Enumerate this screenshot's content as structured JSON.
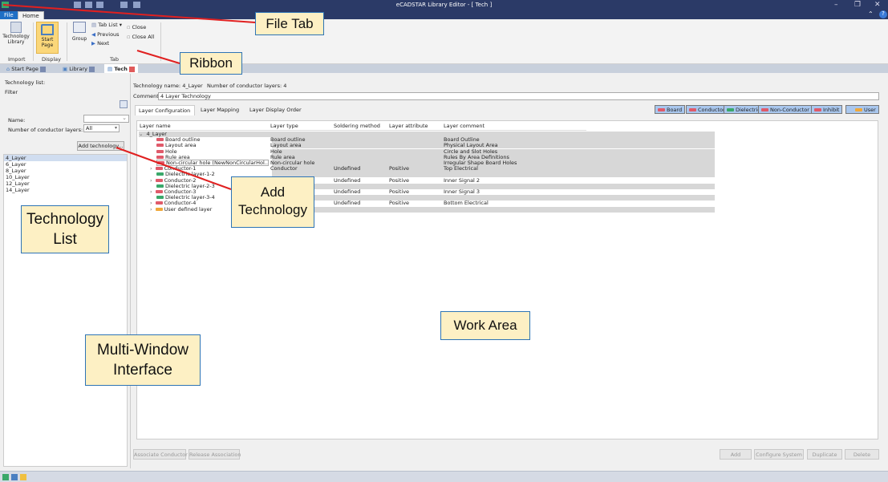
{
  "window": {
    "title": "eCADSTAR Library Editor - [ Tech ]",
    "controls": [
      "–",
      "❐",
      "✕"
    ]
  },
  "ribbon_tabs": {
    "file": "File",
    "home": "Home"
  },
  "ribbon": {
    "technology_library": "Technology Library",
    "start_page": "Start Page",
    "group": "Group",
    "tab_list": "Tab List",
    "previous": "Previous",
    "next": "Next",
    "close": "Close",
    "close_all": "Close All",
    "group_import": "Import",
    "group_display": "Display",
    "group_tab": "Tab"
  },
  "doc_tabs": [
    "Start Page",
    "Library",
    "Tech"
  ],
  "left_panel": {
    "title": "Technology list:",
    "filter": "Filter",
    "name_label": "Name:",
    "layers_label": "Number of conductor layers:",
    "layers_value": "All",
    "add_button": "Add technology...",
    "items": [
      "4_Layer",
      "6_Layer",
      "8_Layer",
      "10_Layer",
      "12_Layer",
      "14_Layer"
    ]
  },
  "main": {
    "technology_name_label": "Technology name:",
    "technology_name": "4_Layer",
    "conductor_layers_label": "Number of conductor layers:",
    "conductor_layers": "4",
    "comment_label": "Comment:",
    "comment": "4 Layer Technology",
    "tabs": [
      "Layer Configuration",
      "Layer Mapping",
      "Layer Display Order"
    ],
    "filters": [
      "Board",
      "Conductor",
      "Dielectric",
      "Non-Conductor",
      "Inhibit",
      "User"
    ],
    "columns": [
      "Layer name",
      "Layer type",
      "Soldering method",
      "Layer attribute",
      "Layer comment"
    ],
    "rows": [
      {
        "name": "4_Layer",
        "type": "",
        "solder": "",
        "attr": "",
        "comment": ""
      },
      {
        "name": "Board outline",
        "type": "Board outline",
        "solder": "",
        "attr": "",
        "comment": "Board Outline"
      },
      {
        "name": "Layout area",
        "type": "Layout area",
        "solder": "",
        "attr": "",
        "comment": "Physical Layout Area"
      },
      {
        "name": "Hole",
        "type": "Hole",
        "solder": "",
        "attr": "",
        "comment": "Circle and Slot Holes"
      },
      {
        "name": "Rule area",
        "type": "Rule area",
        "solder": "",
        "attr": "",
        "comment": "Rules By Area Definitions"
      },
      {
        "name": "Non-circular hole (NewNonCircularHol...",
        "type": "Non-circular hole",
        "solder": "",
        "attr": "",
        "comment": "Irregular Shape Board Holes"
      },
      {
        "name": "Conductor-1",
        "type": "Conductor",
        "solder": "Undefined",
        "attr": "Positive",
        "comment": "Top Electrical"
      },
      {
        "name": "Dielectric layer-1-2",
        "type": "",
        "solder": "",
        "attr": "",
        "comment": ""
      },
      {
        "name": "Conductor-2",
        "type": "",
        "solder": "Undefined",
        "attr": "Positive",
        "comment": "Inner Signal 2"
      },
      {
        "name": "Dielectric layer-2-3",
        "type": "",
        "solder": "",
        "attr": "",
        "comment": ""
      },
      {
        "name": "Conductor-3",
        "type": "",
        "solder": "Undefined",
        "attr": "Positive",
        "comment": "Inner Signal 3"
      },
      {
        "name": "Dielectric layer-3-4",
        "type": "",
        "solder": "",
        "attr": "",
        "comment": ""
      },
      {
        "name": "Conductor-4",
        "type": "",
        "solder": "Undefined",
        "attr": "Positive",
        "comment": "Bottom Electrical"
      },
      {
        "name": "User defined layer",
        "type": "",
        "solder": "",
        "attr": "",
        "comment": ""
      }
    ],
    "bottom_left": [
      "Associate Conductor",
      "Release Association"
    ],
    "bottom_right": [
      "Add",
      "Configure System",
      "Duplicate",
      "Delete"
    ]
  },
  "callouts": {
    "file_tab": "File Tab",
    "ribbon": "Ribbon",
    "add_technology": "Add Technology",
    "technology_list": "Technology List",
    "work_area": "Work Area",
    "multi_window": "Multi-Window Interface"
  },
  "colors": {
    "title_bar": "#2b3a67",
    "callout_fill": "#fdf0c4",
    "callout_border": "#2e74b5",
    "arrow": "#e02020",
    "filter_button": "#a9c7ee",
    "red_layer": "#e05a6a",
    "green_layer": "#3aa86a",
    "orange_layer": "#f0a83a"
  }
}
